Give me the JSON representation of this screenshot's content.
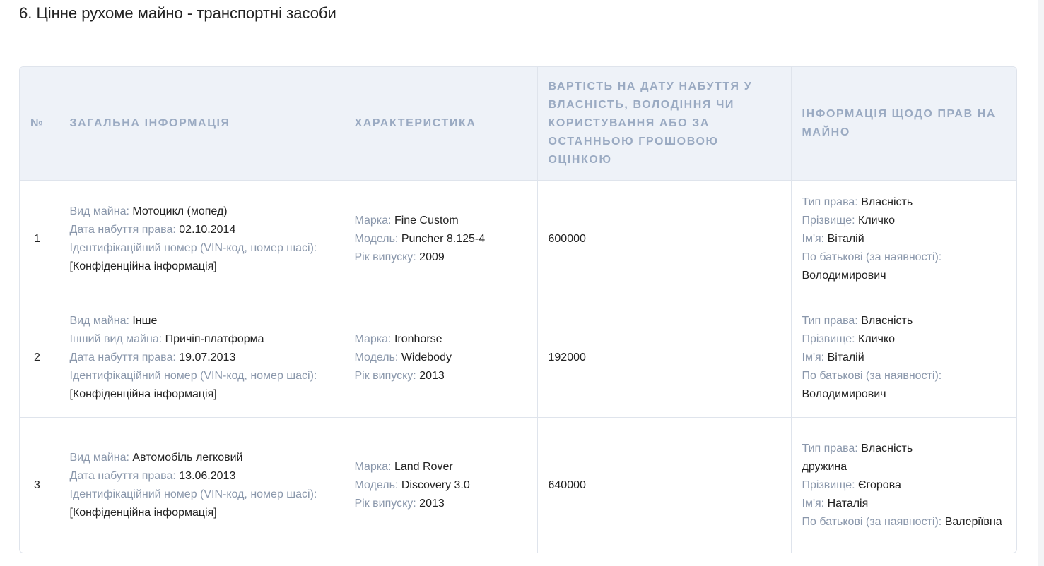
{
  "section": {
    "title": "6. Цінне рухоме майно - транспортні засоби"
  },
  "table": {
    "headers": {
      "num": "№",
      "general": "ЗАГАЛЬНА ІНФОРМАЦІЯ",
      "characteristics": "ХАРАКТЕРИСТИКА",
      "value": "ВАРТІСТЬ НА ДАТУ НАБУТТЯ У ВЛАСНІСТЬ, ВОЛОДІННЯ ЧИ КОРИСТУВАННЯ АБО ЗА ОСТАННЬОЮ ГРОШОВОЮ ОЦІНКОЮ",
      "rights": "ІНФОРМАЦІЯ ЩОДО ПРАВ НА МАЙНО"
    },
    "labels": {
      "kind": "Вид майна:",
      "other_kind": "Інший вид майна:",
      "acq_date": "Дата набуття права:",
      "vin": "Ідентифікаційний номер (VIN-код, номер шасі):",
      "brand": "Марка:",
      "model": "Модель:",
      "year": "Рік випуску:",
      "right_type": "Тип права:",
      "surname": "Прізвище:",
      "name": "Ім'я:",
      "patronymic": "По батькові (за наявності):"
    },
    "rows": [
      {
        "num": "1",
        "kind": "Мотоцикл (мопед)",
        "acq_date": "02.10.2014",
        "vin": "[Конфіденційна інформація]",
        "brand": "Fine Custom",
        "model": "Puncher 8.125-4",
        "year": "2009",
        "value": "600000",
        "right_type": "Власність",
        "surname": "Кличко",
        "name": "Віталій",
        "patronymic": "Володимирович"
      },
      {
        "num": "2",
        "kind": "Інше",
        "other_kind": "Причіп-платформа",
        "acq_date": "19.07.2013",
        "vin": "[Конфіденційна інформація]",
        "brand": "Ironhorse",
        "model": "Widebody",
        "year": "2013",
        "value": "192000",
        "right_type": "Власність",
        "surname": "Кличко",
        "name": "Віталій",
        "patronymic": "Володимирович"
      },
      {
        "num": "3",
        "kind": "Автомобіль легковий",
        "acq_date": "13.06.2013",
        "vin": "[Конфіденційна інформація]",
        "brand": "Land Rover",
        "model": "Discovery 3.0",
        "year": "2013",
        "value": "640000",
        "right_type": "Власність",
        "relation": "дружина",
        "surname": "Єгорова",
        "name": "Наталія",
        "patronymic": "Валеріївна"
      }
    ]
  }
}
